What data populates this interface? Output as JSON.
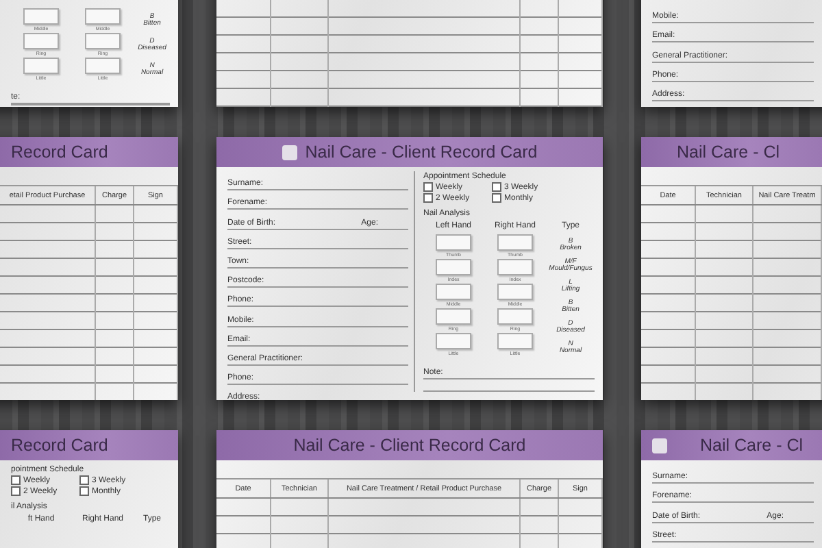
{
  "cards": [
    {
      "kind": "front",
      "hands": {
        "fingers": [
          {
            "left": "Middle",
            "right": "Middle"
          },
          {
            "left": "Ring",
            "right": "Ring"
          },
          {
            "left": "Little",
            "right": "Little"
          }
        ],
        "types": [
          {
            "code": "B",
            "label": "Bitten"
          },
          {
            "code": "D",
            "label": "Diseased"
          },
          {
            "code": "N",
            "label": "Normal"
          }
        ]
      },
      "note": "te:"
    },
    {
      "kind": "back"
    },
    {
      "kind": "front",
      "fields": [
        {
          "label": "Mobile:"
        },
        {
          "label": "Email:"
        },
        {
          "label": "General Practitioner:"
        },
        {
          "label": "Phone:"
        },
        {
          "label": "Address:"
        }
      ]
    },
    {
      "kind": "back",
      "title": "Record Card",
      "columns": [
        "etail Product Purchase",
        "Charge",
        "Sign"
      ]
    },
    {
      "kind": "front",
      "logo": true,
      "title": "Nail Care - Client Record Card",
      "fields": [
        {
          "label": "Surname:"
        },
        {
          "label": "Forename:"
        },
        {
          "label": "Date of Birth:",
          "extra": "Age:"
        },
        {
          "label": "Street:"
        },
        {
          "label": "Town:"
        },
        {
          "label": "Postcode:"
        },
        {
          "label": "Phone:"
        },
        {
          "label": "Mobile:"
        },
        {
          "label": "Email:"
        },
        {
          "label": "General Practitioner:"
        },
        {
          "label": "Phone:"
        },
        {
          "label": "Address:"
        }
      ],
      "schedule": {
        "title": "Appointment Schedule",
        "options": [
          {
            "label": "Weekly",
            "checked": false
          },
          {
            "label": "3 Weekly",
            "checked": false
          },
          {
            "label": "2 Weekly",
            "checked": false
          },
          {
            "label": "Monthly",
            "checked": false
          }
        ]
      },
      "analysis_title": "Nail Analysis",
      "hands": {
        "headers": [
          "Left Hand",
          "Right Hand",
          "Type"
        ],
        "fingers": [
          {
            "left": "Thumb",
            "right": "Thumb"
          },
          {
            "left": "Index",
            "right": "Index"
          },
          {
            "left": "Middle",
            "right": "Middle"
          },
          {
            "left": "Ring",
            "right": "Ring"
          },
          {
            "left": "Little",
            "right": "Little"
          }
        ],
        "types": [
          {
            "code": "B",
            "label": "Broken"
          },
          {
            "code": "M/F",
            "label": "Mould/Fungus"
          },
          {
            "code": "L",
            "label": "Lifting"
          },
          {
            "code": "B",
            "label": "Bitten"
          },
          {
            "code": "D",
            "label": "Diseased"
          },
          {
            "code": "N",
            "label": "Normal"
          }
        ]
      },
      "note": "Note:"
    },
    {
      "kind": "back",
      "title": "Nail Care - Cl",
      "columns": [
        "Date",
        "Technician",
        "Nail Care Treatm"
      ]
    },
    {
      "kind": "front",
      "title": "Record Card",
      "schedule": {
        "title": "pointment Schedule",
        "options": [
          {
            "label": "Weekly",
            "checked": false
          },
          {
            "label": "3 Weekly",
            "checked": false
          },
          {
            "label": "2 Weekly",
            "checked": false
          },
          {
            "label": "Monthly",
            "checked": false
          }
        ]
      },
      "analysis_title": "il Analysis",
      "hands": {
        "headers": [
          "ft Hand",
          "Right Hand",
          "Type"
        ]
      }
    },
    {
      "kind": "back",
      "title": "Nail Care - Client Record Card",
      "columns": [
        "Date",
        "Technician",
        "Nail Care Treatment / Retail Product Purchase",
        "Charge",
        "Sign"
      ]
    },
    {
      "kind": "front",
      "logo": true,
      "title": "Nail Care - Cl",
      "fields": [
        {
          "label": "Surname:"
        },
        {
          "label": "Forename:"
        },
        {
          "label": "Date of Birth:",
          "extra": "Age:"
        },
        {
          "label": "Street:"
        }
      ]
    }
  ]
}
